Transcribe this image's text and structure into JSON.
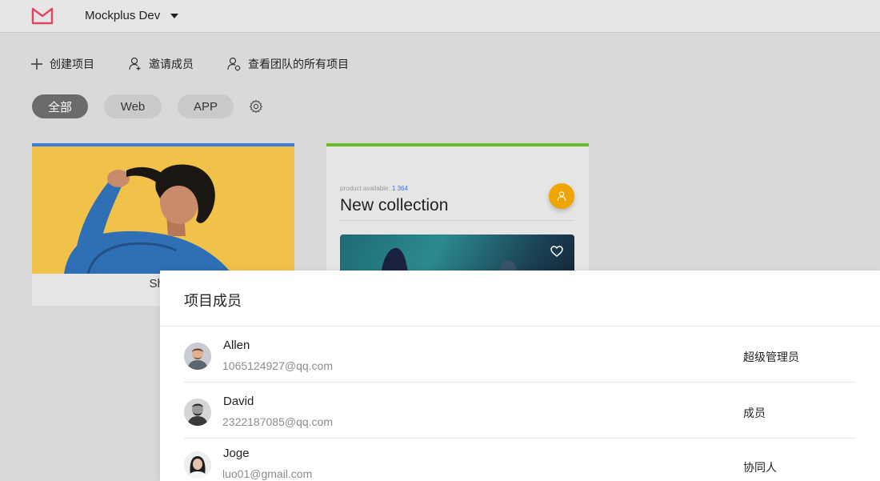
{
  "header": {
    "project_name": "Mockplus Dev",
    "brand_color": "#e0455f"
  },
  "actions": {
    "create": "创建项目",
    "invite": "邀请成员",
    "team_projects": "查看团队的所有项目"
  },
  "filters": {
    "all": "全部",
    "web": "Web",
    "app": "APP",
    "selected": "全部"
  },
  "cards": [
    {
      "label": "Shop",
      "accent": "#3b7ddd"
    },
    {
      "accent": "#6cbb2a",
      "small_text": "product available: ",
      "small_value": "1 364",
      "title": "New collection"
    }
  ],
  "panel": {
    "title": "项目成员",
    "members": [
      {
        "name": "Allen",
        "email": "1065124927@qq.com",
        "role": "超级管理员"
      },
      {
        "name": "David",
        "email": "2322187085@qq.com",
        "role": "成员"
      },
      {
        "name": "Joge",
        "email": "luo01@gmail.com",
        "role": "协同人"
      }
    ]
  }
}
